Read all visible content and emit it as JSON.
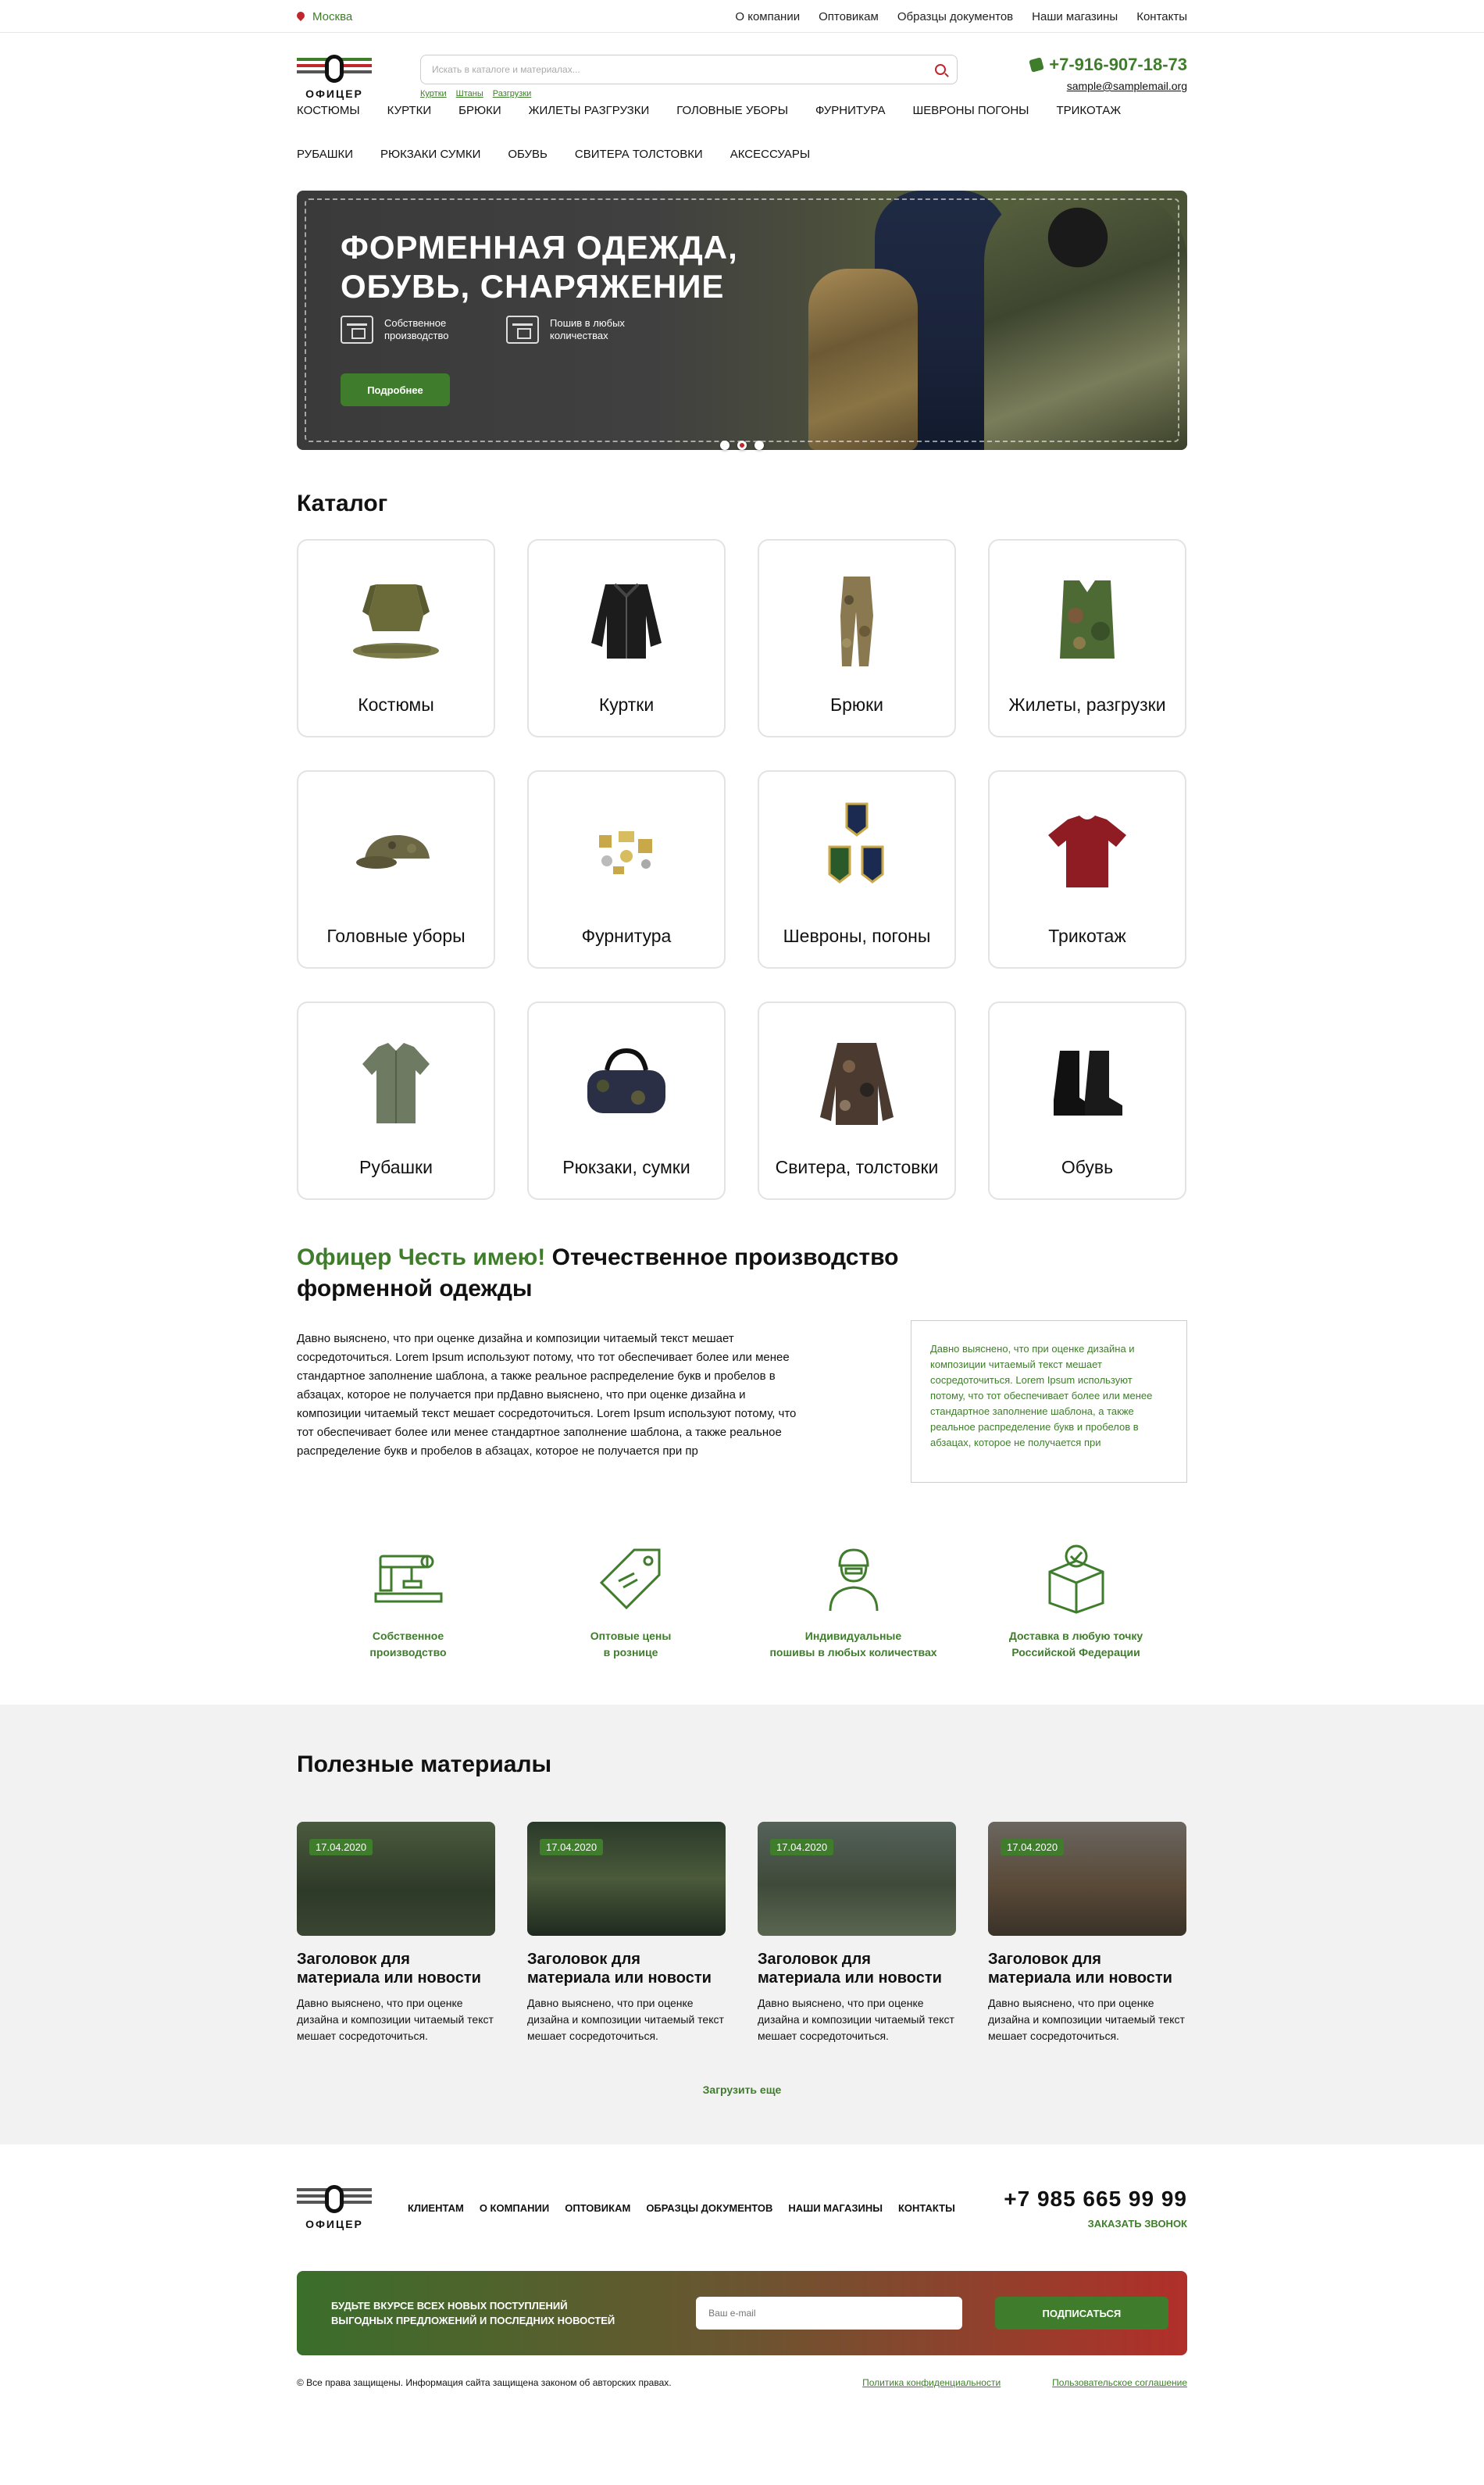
{
  "colors": {
    "accent": "#3f7d2c",
    "red": "#c0272d",
    "dark": "#111111"
  },
  "topbar": {
    "city": "Москва",
    "links": [
      "О компании",
      "Оптовикам",
      "Образцы документов",
      "Наши магазины",
      "Контакты"
    ]
  },
  "header": {
    "logo_text": "ОФИЦЕР",
    "search_placeholder": "Искать в каталоге и материалах...",
    "search_hints": [
      "Куртки",
      "Штаны",
      "Разгрузки"
    ],
    "phone": "+7-916-907-18-73",
    "email": "sample@samplemail.org"
  },
  "nav": {
    "row1": [
      "Костюмы",
      "Куртки",
      "Брюки",
      "Жилеты разгрузки",
      "Головные уборы",
      "Фурнитура",
      "Шевроны погоны",
      "Трикотаж"
    ],
    "row2": [
      "Рубашки",
      "Рюкзаки сумки",
      "Обувь",
      "Свитера толстовки",
      "Аксессуары"
    ]
  },
  "hero": {
    "title": "ФОРМЕННАЯ ОДЕЖДА, ОБУВЬ, СНАРЯЖЕНИЕ",
    "features": [
      "Собственное производство",
      "Пошив в любых количествах"
    ],
    "button": "Подробнее",
    "slides": 3,
    "active_slide": 2
  },
  "catalog": {
    "title": "Каталог",
    "items": [
      {
        "label": "Костюмы",
        "icon": "suit-icon"
      },
      {
        "label": "Куртки",
        "icon": "jacket-icon"
      },
      {
        "label": "Брюки",
        "icon": "trousers-icon"
      },
      {
        "label": "Жилеты, разгрузки",
        "icon": "vest-icon"
      },
      {
        "label": "Головные уборы",
        "icon": "cap-icon"
      },
      {
        "label": "Фурнитура",
        "icon": "fittings-icon"
      },
      {
        "label": "Шевроны, погоны",
        "icon": "patches-icon"
      },
      {
        "label": "Трикотаж",
        "icon": "tshirt-icon"
      },
      {
        "label": "Рубашки",
        "icon": "shirt-icon"
      },
      {
        "label": "Рюкзаки, сумки",
        "icon": "bag-icon"
      },
      {
        "label": "Свитера, толстовки",
        "icon": "sweater-icon"
      },
      {
        "label": "Обувь",
        "icon": "boots-icon"
      }
    ]
  },
  "about": {
    "title_accent": "Офицер Честь имею!",
    "title_rest": " Отечественное производство форменной одежды",
    "text": "Давно выяснено, что при оценке дизайна и композиции читаемый текст мешает сосредоточиться. Lorem Ipsum используют потому, что тот обеспечивает более или менее стандартное заполнение шаблона, а также реальное распределение букв и пробелов в абзацах, которое не получается при прДавно выяснено, что при оценке дизайна и композиции читаемый текст мешает сосредоточиться. Lorem Ipsum используют потому, что тот обеспечивает более или менее стандартное заполнение шаблона, а также реальное распределение букв и пробелов в абзацах, которое не получается при пр",
    "quote": "Давно выяснено, что при оценке дизайна и композиции читаемый текст мешает сосредоточиться. Lorem Ipsum используют потому, что тот обеспечивает более или менее стандартное заполнение шаблона, а также реальное распределение букв и пробелов в абзацах, которое не получается при"
  },
  "benefits": [
    {
      "label": "Собственное\nпроизводство",
      "icon": "sewing-machine-icon"
    },
    {
      "label": "Оптовые цены\nв рознице",
      "icon": "price-tag-icon"
    },
    {
      "label": "Индивидуальные\nпошивы в любых количествах",
      "icon": "soldier-icon"
    },
    {
      "label": "Доставка в любую точку\nРоссийской Федерации",
      "icon": "delivery-box-icon"
    }
  ],
  "materials": {
    "title": "Полезные материалы",
    "items": [
      {
        "date": "17.04.2020",
        "title": "Заголовок для материала или новости",
        "text": "Давно выяснено, что при оценке дизайна и композиции читаемый текст мешает сосредоточиться."
      },
      {
        "date": "17.04.2020",
        "title": "Заголовок для материала или новости",
        "text": "Давно выяснено, что при оценке дизайна и композиции читаемый текст мешает сосредоточиться."
      },
      {
        "date": "17.04.2020",
        "title": "Заголовок для материала или новости",
        "text": "Давно выяснено, что при оценке дизайна и композиции читаемый текст мешает сосредоточиться."
      },
      {
        "date": "17.04.2020",
        "title": "Заголовок для материала или новости",
        "text": "Давно выяснено, что при оценке дизайна и композиции читаемый текст мешает сосредоточиться."
      }
    ],
    "load_more": "Загрузить еще"
  },
  "footer": {
    "nav": [
      "Клиентам",
      "О компании",
      "Оптовикам",
      "Образцы документов",
      "Наши магазины",
      "Контакты"
    ],
    "phone": "+7 985 665 99 99",
    "callback": "Заказать звонок",
    "subscribe_text": "Будьте вкурсе всех новых поступлений\nвыгодных предложений и последних новостей",
    "email_placeholder": "Ваш e-mail",
    "subscribe_button": "Подписаться",
    "copyright": "© Все права защищены. Информация сайта защищена законом об авторских правах.",
    "privacy": "Политика конфиденциальности",
    "agreement": "Пользовательское соглашение"
  }
}
